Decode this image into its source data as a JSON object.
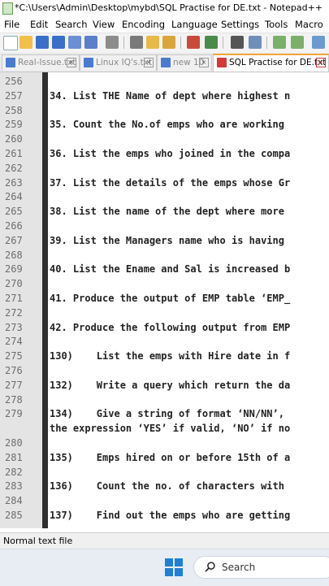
{
  "window": {
    "title": "*C:\\Users\\Admin\\Desktop\\mybd\\SQL Practise for DE.txt - Notepad++"
  },
  "menu": [
    "File",
    "Edit",
    "Search",
    "View",
    "Encoding",
    "Language",
    "Settings",
    "Tools",
    "Macro"
  ],
  "tabs": [
    {
      "label": "Real-Issue.txt",
      "close": "×"
    },
    {
      "label": "Linux IQ's.txt",
      "close": "×"
    },
    {
      "label": "new 10",
      "close": "×"
    },
    {
      "label": "SQL Practise for DE.txt",
      "close": "×"
    }
  ],
  "editor": {
    "lines": [
      {
        "num": "256",
        "text": ""
      },
      {
        "num": "257",
        "text": "34. List THE Name of dept where highest n"
      },
      {
        "num": "258",
        "text": ""
      },
      {
        "num": "259",
        "text": "35. Count the No.of emps who are working "
      },
      {
        "num": "260",
        "text": ""
      },
      {
        "num": "261",
        "text": "36. List the emps who joined in the compa"
      },
      {
        "num": "262",
        "text": ""
      },
      {
        "num": "263",
        "text": "37. List the details of the emps whose Gr"
      },
      {
        "num": "264",
        "text": ""
      },
      {
        "num": "265",
        "text": "38. List the name of the dept where more "
      },
      {
        "num": "266",
        "text": ""
      },
      {
        "num": "267",
        "text": "39. List the Managers name who is having "
      },
      {
        "num": "268",
        "text": ""
      },
      {
        "num": "269",
        "text": "40. List the Ename and Sal is increased b"
      },
      {
        "num": "270",
        "text": ""
      },
      {
        "num": "271",
        "text": "41. Produce the output of EMP table ‘EMP_"
      },
      {
        "num": "272",
        "text": ""
      },
      {
        "num": "273",
        "text": "42. Produce the following output from EMP"
      },
      {
        "num": "274",
        "text": ""
      },
      {
        "num": "275",
        "text": "130)    List the emps with Hire date in f"
      },
      {
        "num": "276",
        "text": ""
      },
      {
        "num": "277",
        "text": "132)    Write a query which return the da"
      },
      {
        "num": "278",
        "text": ""
      },
      {
        "num": "279",
        "text": "134)    Give a string of format ‘NN/NN’, "
      },
      {
        "num": "",
        "text": "the expression ‘YES’ if valid, ‘NO’ if no"
      },
      {
        "num": "280",
        "text": ""
      },
      {
        "num": "281",
        "text": "135)    Emps hired on or before 15th of a"
      },
      {
        "num": "282",
        "text": ""
      },
      {
        "num": "283",
        "text": "136)    Count the no. of characters with "
      },
      {
        "num": "284",
        "text": ""
      },
      {
        "num": "285",
        "text": "137)    Find out the emps who are getting"
      }
    ]
  },
  "status": {
    "filetype": "Normal text file"
  },
  "taskbar": {
    "search_placeholder": "Search"
  },
  "colors": {
    "active_tab_accent": "#f3a53b",
    "gutter_bg": "#e4e4e4",
    "fold_bar": "#2f2f2f"
  }
}
